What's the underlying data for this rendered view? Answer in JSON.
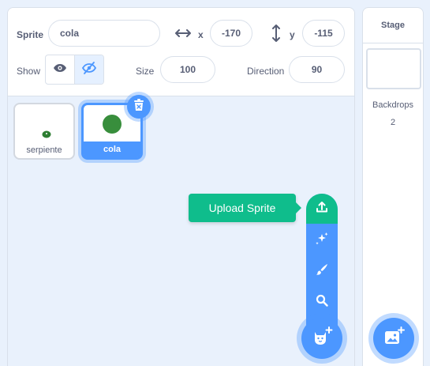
{
  "sprite_info": {
    "sprite_label": "Sprite",
    "sprite_name": "cola",
    "x_label": "x",
    "x_value": "-170",
    "y_label": "y",
    "y_value": "-115",
    "show_label": "Show",
    "size_label": "Size",
    "size_value": "100",
    "direction_label": "Direction",
    "direction_value": "90",
    "visible": true
  },
  "sprites": [
    {
      "name": "serpiente",
      "selected": false,
      "thumbnail_color": "#2e7d32"
    },
    {
      "name": "cola",
      "selected": true,
      "thumbnail_color": "#388e3c"
    }
  ],
  "add_sprite_menu": {
    "tooltip": "Upload Sprite",
    "items": [
      "upload-icon",
      "surprise-icon",
      "paint-icon",
      "search-icon"
    ],
    "main_button_icon": "cat-plus-icon"
  },
  "stage": {
    "title": "Stage",
    "backdrops_label": "Backdrops",
    "backdrops_count": "2",
    "add_backdrop_icon": "image-plus-icon"
  },
  "colors": {
    "accent": "#4c97ff",
    "upload_green": "#0fbd8c",
    "background": "#e9f1fc",
    "text": "#575e75"
  }
}
